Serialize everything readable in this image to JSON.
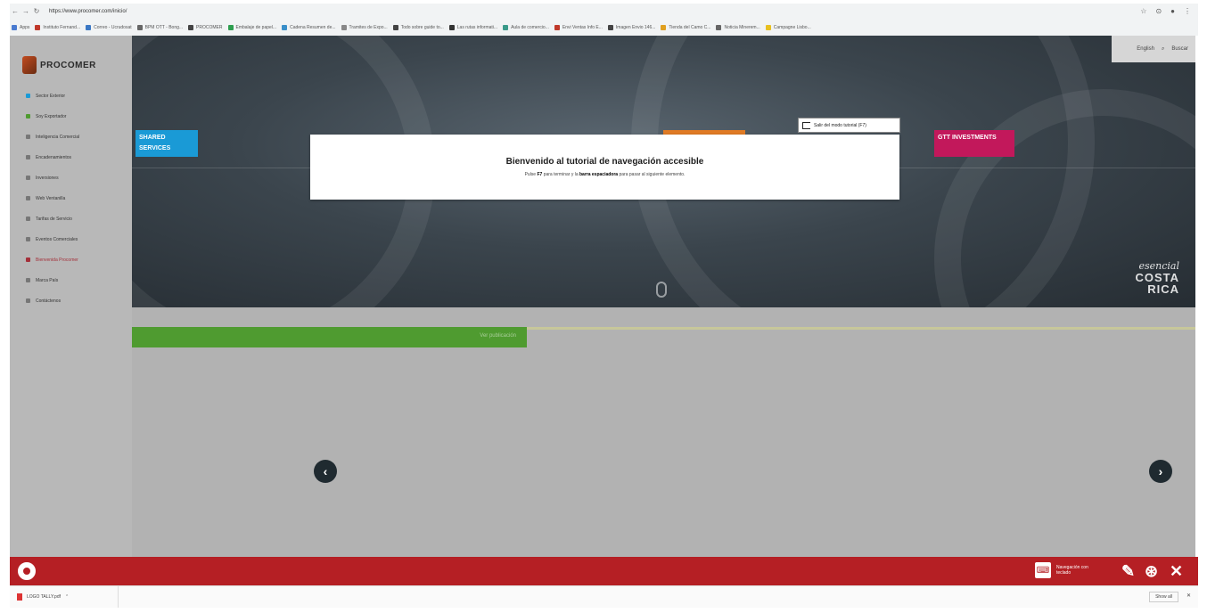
{
  "browser": {
    "url": "https://www.procomer.com/inicio/",
    "nav": {
      "back": "←",
      "forward": "→",
      "reload": "↻",
      "lock": "🔒"
    },
    "bookmarks": [
      {
        "label": "Apps",
        "color": "#4a7bd0"
      },
      {
        "label": "Instituto Fernand...",
        "color": "#c0392b"
      },
      {
        "label": "Correo - Ucrudosat",
        "color": "#3b78c4"
      },
      {
        "label": "BPM OTT - Bong...",
        "color": "#666666"
      },
      {
        "label": "PROCOMER",
        "color": "#444444"
      },
      {
        "label": "Embalaje de papel...",
        "color": "#2e9e4f"
      },
      {
        "label": "Cadena Resumen de...",
        "color": "#3a8fc9"
      },
      {
        "label": "Tramites de Expo...",
        "color": "#888888"
      },
      {
        "label": "Todo sobre guide to...",
        "color": "#444444"
      },
      {
        "label": "Las rutas informati...",
        "color": "#333333"
      },
      {
        "label": "Aula de comercio...",
        "color": "#3a9a8a"
      },
      {
        "label": "Envi Ventas Info E...",
        "color": "#c0392b"
      },
      {
        "label": "Imagen Envio 146...",
        "color": "#444444"
      },
      {
        "label": "Tienda del Camo C...",
        "color": "#e0a020"
      },
      {
        "label": "Noticia Minerem...",
        "color": "#666666"
      },
      {
        "label": "Campagne Lisbo...",
        "color": "#e8c020"
      }
    ]
  },
  "sidebar": {
    "logo_text": "PROCOMER",
    "items": [
      {
        "label": "Sector Exterior",
        "color": "#1a9ad6"
      },
      {
        "label": "Soy Exportador",
        "color": "#4f9b30"
      },
      {
        "label": "Inteligencia Comercial",
        "color": "#777777"
      },
      {
        "label": "Encadenamientos",
        "color": "#777777"
      },
      {
        "label": "Inversiones",
        "color": "#777777"
      },
      {
        "label": "Web Ventanilla",
        "color": "#777777"
      },
      {
        "label": "Tarifas de Servicio",
        "color": "#777777"
      },
      {
        "label": "Eventos Comerciales",
        "color": "#777777"
      },
      {
        "label": "Bienvenida Procomer",
        "color": "#a4303a"
      },
      {
        "label": "Marca País",
        "color": "#777777"
      },
      {
        "label": "Contáctenos",
        "color": "#777777"
      }
    ]
  },
  "header": {
    "lang": "English",
    "search": "Buscar"
  },
  "hero": {
    "tag_left": "SHARED SERVICES",
    "tag_right": "GTT INVESTMENTS",
    "brand_script": "esencial",
    "brand_line1": "COSTA",
    "brand_line2": "RICA"
  },
  "modal": {
    "exit_label": "Salir del modo tutorial (F7)",
    "title": "Bienvenido al tutorial de navegación accesible",
    "sub_pre": "Pulse",
    "sub_key1": "F7",
    "sub_mid": "para terminar y la",
    "sub_key2": "barra espaciadora",
    "sub_post": "para pasar al siguiente elemento."
  },
  "lower": {
    "green_caption": "Ver publicación"
  },
  "accessbar": {
    "keyboard_label": "Navegación con teclado",
    "icons": {
      "keyboard": "keyboard-icon",
      "speech": "speech-icon",
      "help": "help-icon",
      "close": "close-icon"
    }
  },
  "downloads": {
    "file": "LOGO TALLY.pdf",
    "show_all": "Show all"
  }
}
